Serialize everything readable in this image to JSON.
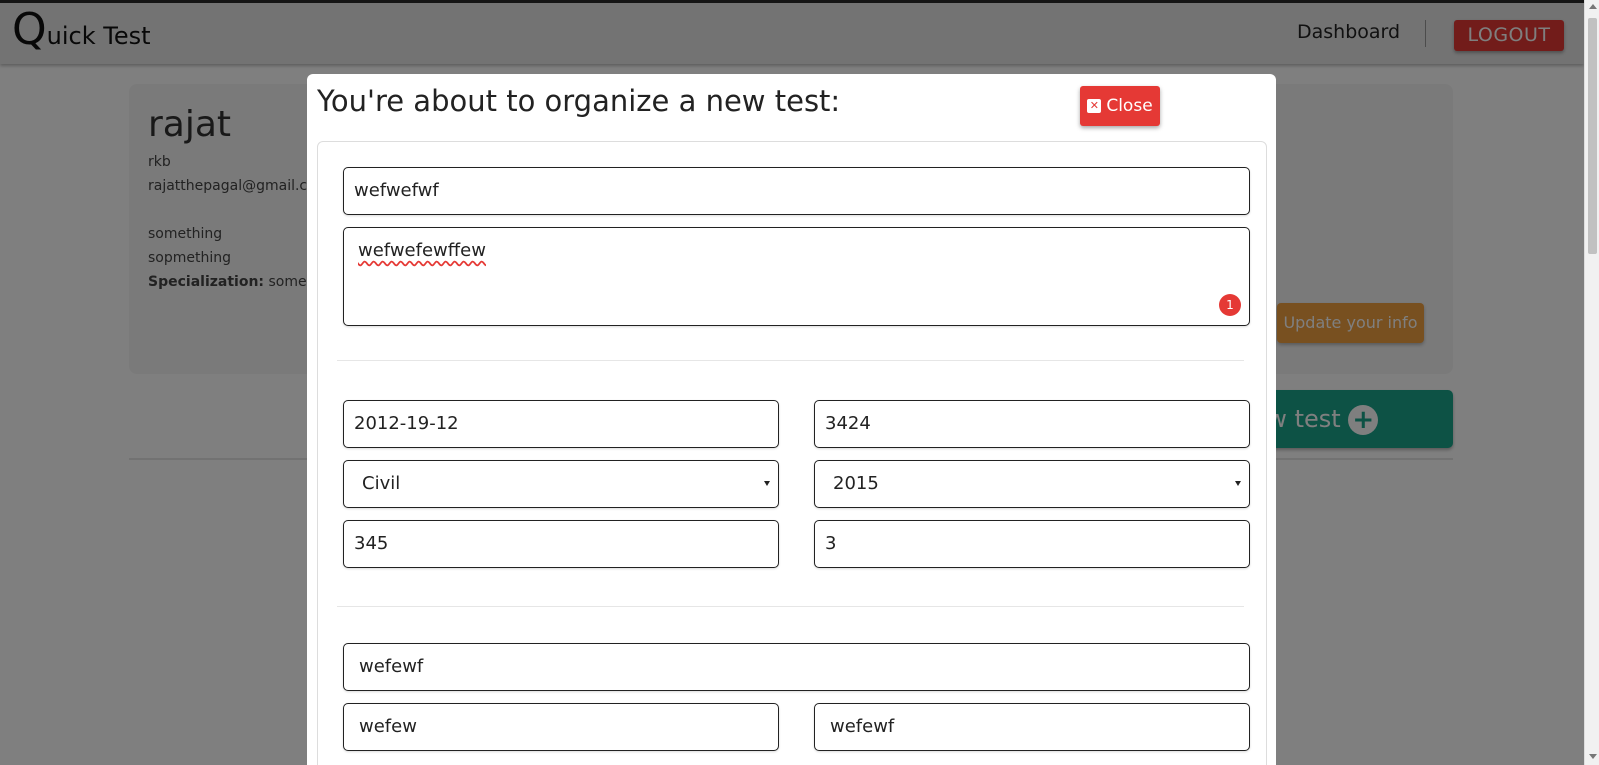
{
  "navbar": {
    "brand_q": "Q",
    "brand_rest": "uick Test",
    "dashboard_label": "Dashboard",
    "logout_label": "LOGOUT"
  },
  "profile": {
    "name": "rajat",
    "username": "rkb",
    "email": "rajatthepagal@gmail.co",
    "line1": "something",
    "line2": "sopmething",
    "specialization_label": "Specialization:",
    "specialization_value": "somethin",
    "update_button": "Update your info",
    "organize_button": "ze a new test"
  },
  "modal": {
    "title": "You're about to organize a new test:",
    "close_label": "Close",
    "test_name": "wefwefwf",
    "description": "wefwefewffew",
    "description_badge": "1",
    "date": "2012-19-12",
    "duration": "3424",
    "branch_select": "Civil",
    "year_select": "2015",
    "field_a": "345",
    "field_b": "3",
    "question": "wefewf",
    "option_a": "wefew",
    "option_b": "wefewf"
  },
  "colors": {
    "accent_red": "#e53935",
    "teal": "#1aa58a",
    "orange": "#f0a040"
  }
}
